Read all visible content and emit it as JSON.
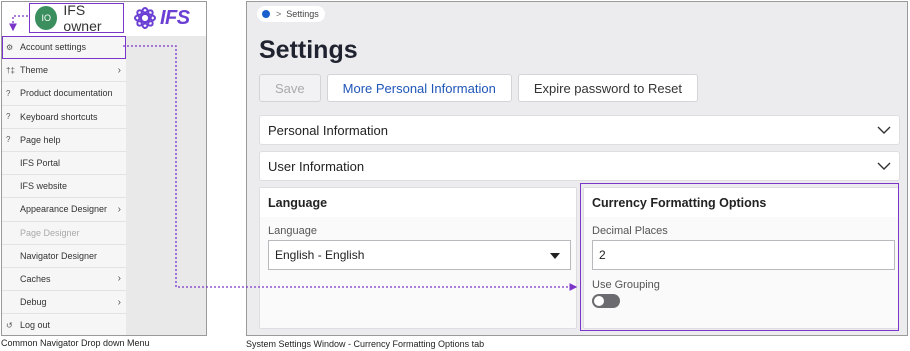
{
  "user": {
    "initials": "IO",
    "name": "IFS owner"
  },
  "logo": {
    "text": "IFS",
    "color": "#6b3fd4"
  },
  "menu": {
    "items": [
      {
        "label": "Account settings",
        "icon": "gear-icon",
        "glyph": "⚙",
        "chevron": false,
        "active": true
      },
      {
        "label": "Theme",
        "icon": "palette-icon",
        "glyph": "†‡",
        "chevron": true
      },
      {
        "label": "Product documentation",
        "icon": "help-circle-icon",
        "glyph": "?",
        "chevron": false
      },
      {
        "label": "Keyboard shortcuts",
        "icon": "help-circle-icon",
        "glyph": "?",
        "chevron": false
      },
      {
        "label": "Page help",
        "icon": "help-circle-icon",
        "glyph": "?",
        "chevron": false
      },
      {
        "label": "IFS Portal",
        "chevron": false
      },
      {
        "label": "IFS website",
        "chevron": false
      },
      {
        "label": "Appearance Designer",
        "chevron": true
      },
      {
        "label": "Page Designer",
        "chevron": false,
        "disabled": true
      },
      {
        "label": "Navigator Designer",
        "chevron": false
      },
      {
        "label": "Caches",
        "chevron": true
      },
      {
        "label": "Debug",
        "chevron": true
      },
      {
        "label": "Log out",
        "icon": "logout-icon",
        "glyph": "↺",
        "chevron": false
      }
    ]
  },
  "captions": {
    "left": "Common Navigator Drop down Menu",
    "right": "System Settings Window - Currency Formatting Options tab"
  },
  "breadcrumb": {
    "separator": ">",
    "current": "Settings"
  },
  "page": {
    "title": "Settings"
  },
  "toolbar": {
    "save": "Save",
    "more_info": "More Personal Information",
    "expire": "Expire password to Reset"
  },
  "sections": {
    "personal": "Personal Information",
    "user": "User Information"
  },
  "language": {
    "title": "Language",
    "field_label": "Language",
    "value": "English - English"
  },
  "currency": {
    "title": "Currency Formatting Options",
    "decimal_label": "Decimal Places",
    "decimal_value": "2",
    "grouping_label": "Use Grouping",
    "grouping_on": false
  },
  "colors": {
    "highlight": "#7b35c9",
    "primary_text": "#1f56b8",
    "avatar": "#3b8f5e"
  }
}
